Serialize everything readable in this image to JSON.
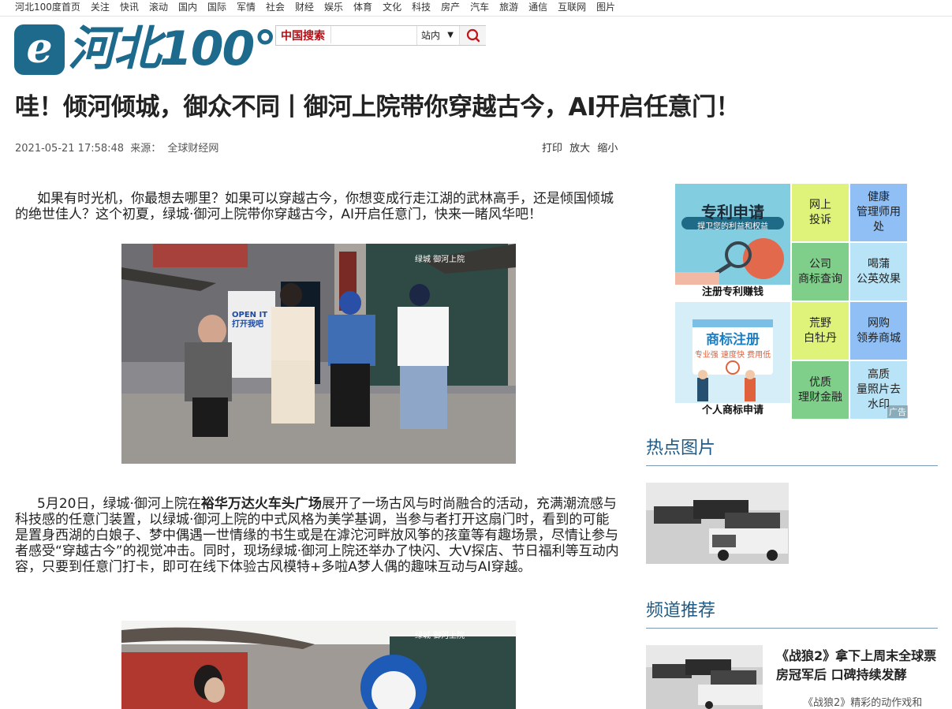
{
  "top_nav": [
    "河北100度首页",
    "关注",
    "快讯",
    "滚动",
    "国内",
    "国际",
    "军情",
    "社会",
    "财经",
    "娱乐",
    "体育",
    "文化",
    "科技",
    "房产",
    "汽车",
    "旅游",
    "通信",
    "互联网",
    "图片"
  ],
  "logo": {
    "mark": "e",
    "text": "河北100°"
  },
  "search": {
    "label": "中国搜索",
    "placeholder": "",
    "scope": "站内",
    "arrow": "▼"
  },
  "article": {
    "title": "哇！倾河倾城，御众不同丨御河上院带你穿越古今，AI开启任意门！",
    "datetime": "2021-05-21 17:58:48",
    "source_label": "来源：",
    "source": "全球财经网",
    "tools": {
      "print": "打印",
      "zoom_in": "放大",
      "zoom_out": "缩小"
    },
    "para1": "如果有时光机，你最想去哪里？如果可以穿越古今，你想变成行走江湖的武林高手，还是倾国倾城的绝世佳人？这个初夏，绿城·御河上院带你穿越古今，AI开启任意门，快来一睹风华吧！",
    "para2_a": "5月20日，绿城·御河上院在",
    "para2_bold": "裕华万达火车头广场",
    "para2_b": "展开了一场古风与时尚融合的活动，充满潮流感与科技感的任意门装置，以绿城·御河上院的中式风格为美学基调，当参与者打开这扇门时，看到的可能是置身西湖的白娘子、梦中偶遇一世情缘的书生或是在滹沱河畔放风筝的孩童等有趣场景，尽情让参与者感受“穿越古今”的视觉冲击。同时，现场绿城·御河上院还举办了快闪、大V探店、节日福利等互动内容，只要到任意门打卡，即可在线下体验古风模特+多啦A梦人偶的趣味互动与AI穿越。",
    "photo1_sign": "OPEN IT\n打开我吧",
    "photo_watermark": "绿城 御河上院"
  },
  "sidebar": {
    "ad_patent": {
      "title": "专利申请",
      "sub": "捍卫您的利益和权益",
      "caption": "注册专利赚钱"
    },
    "ad_trademark": {
      "title": "商标注册",
      "sub": "专业强  速度快  费用低",
      "caption": "个人商标申请"
    },
    "tiles": [
      {
        "label": "网上\n投诉",
        "color": "#dff27a"
      },
      {
        "label": "健康\n管理师用处",
        "color": "#8fbff5"
      },
      {
        "label": "公司\n商标查询",
        "color": "#7fcf8a"
      },
      {
        "label": "喝蒲\n公英效果",
        "color": "#b9e4f7"
      },
      {
        "label": "荒野\n白牡丹",
        "color": "#dff27a"
      },
      {
        "label": "网购\n领券商城",
        "color": "#8fbff5"
      },
      {
        "label": "优质\n理财金融",
        "color": "#7fcf8a"
      },
      {
        "label": "高质\n量照片去水印",
        "color": "#b9e4f7"
      }
    ],
    "ad_tag": "广告",
    "hot_title": "热点图片",
    "channel_title": "频道推荐",
    "rec_title": "《战狼2》拿下上周末全球票房冠军后 口碑持续发酵",
    "rec_summary": "《战狼2》精彩的动作戏和"
  }
}
